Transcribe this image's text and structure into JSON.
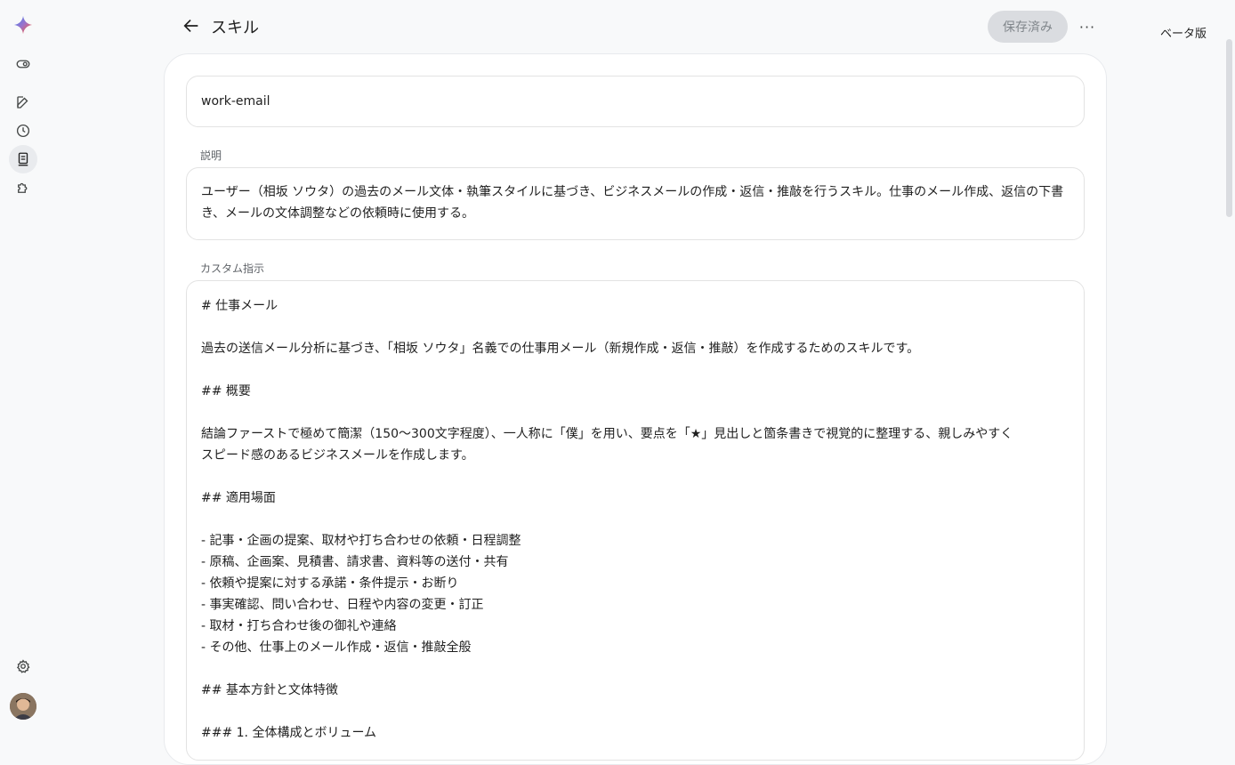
{
  "rail": {
    "items": [
      {
        "name": "gemini-logo-icon"
      },
      {
        "name": "toggle-icon"
      },
      {
        "name": "edit-icon"
      },
      {
        "name": "history-icon"
      },
      {
        "name": "skills-icon"
      },
      {
        "name": "extensions-icon"
      },
      {
        "name": "settings-icon"
      }
    ]
  },
  "header": {
    "title": "スキル",
    "saved_label": "保存済み",
    "more_label": "···",
    "beta_label": "ベータ版"
  },
  "form": {
    "name_value": "work-email",
    "description_label": "説明",
    "description_value": "ユーザー（相坂 ソウタ）の過去のメール文体・執筆スタイルに基づき、ビジネスメールの作成・返信・推敲を行うスキル。仕事のメール作成、返信の下書き、メールの文体調整などの依頼時に使用する。",
    "instructions_label": "カスタム指示",
    "instructions_lines": [
      "# 仕事メール",
      "",
      "過去の送信メール分析に基づき、「相坂 ソウタ」名義での仕事用メール（新規作成・返信・推敲）を作成するためのスキルです。",
      "",
      "## 概要",
      "",
      "結論ファーストで極めて簡潔（150〜300文字程度）、一人称に「僕」を用い、要点を「★」見出しと箇条書きで視覚的に整理する、親しみやすく",
      "スピード感のあるビジネスメールを作成します。",
      "",
      "## 適用場面",
      "",
      "- 記事・企画の提案、取材や打ち合わせの依頼・日程調整",
      "- 原稿、企画案、見積書、請求書、資料等の送付・共有",
      "- 依頼や提案に対する承諾・条件提示・お断り",
      "- 事実確認、問い合わせ、日程や内容の変更・訂正",
      "- 取材・打ち合わせ後の御礼や連絡",
      "- その他、仕事上のメール作成・返信・推敲全般",
      "",
      "## 基本方針と文体特徴",
      "",
      "### 1. 全体構成とボリューム"
    ]
  }
}
